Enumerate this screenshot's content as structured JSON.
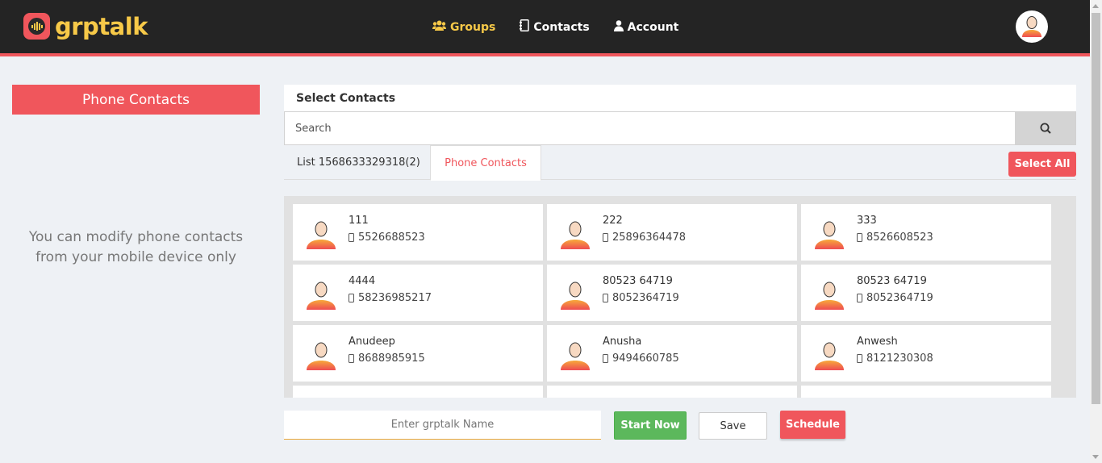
{
  "header": {
    "logo_text": "grptalk",
    "nav": [
      {
        "label": "Groups",
        "icon": "groups-icon",
        "active": true
      },
      {
        "label": "Contacts",
        "icon": "address-book-icon",
        "active": false
      },
      {
        "label": "Account",
        "icon": "user-icon",
        "active": false
      }
    ]
  },
  "left_panel": {
    "title": "Phone Contacts",
    "note": "You can modify phone contacts from your mobile device only"
  },
  "select_contacts": {
    "title": "Select Contacts",
    "search_placeholder": "Search",
    "tabs": [
      {
        "label": "List 1568633329318(2)",
        "active": false
      },
      {
        "label": "Phone Contacts",
        "active": true
      }
    ],
    "select_all_label": "Select All",
    "contacts": [
      {
        "name": "111",
        "phone": "5526688523"
      },
      {
        "name": "222",
        "phone": "25896364478"
      },
      {
        "name": "333",
        "phone": "8526608523"
      },
      {
        "name": "4444",
        "phone": "58236985217"
      },
      {
        "name": "80523 64719",
        "phone": "8052364719"
      },
      {
        "name": "80523 64719",
        "phone": "8052364719"
      },
      {
        "name": "Anudeep",
        "phone": "8688985915"
      },
      {
        "name": "Anusha",
        "phone": "9494660785"
      },
      {
        "name": "Anwesh",
        "phone": "8121230308"
      }
    ]
  },
  "footer": {
    "name_placeholder": "Enter grptalk Name",
    "start_label": "Start Now",
    "save_label": "Save",
    "schedule_label": "Schedule"
  },
  "colors": {
    "accent": "#f0565c",
    "brand_yellow": "#f7c948",
    "header_bg": "#242424",
    "start_green": "#5cb85c"
  }
}
